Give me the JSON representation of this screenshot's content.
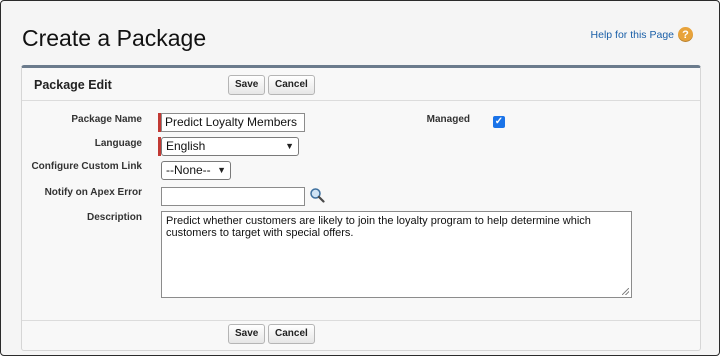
{
  "page": {
    "title": "Create a Package",
    "help_link": "Help for this Page",
    "help_icon": "question-icon"
  },
  "panel": {
    "title": "Package Edit",
    "save_label": "Save",
    "cancel_label": "Cancel"
  },
  "form": {
    "package_name": {
      "label": "Package Name",
      "value": "Predict Loyalty Members",
      "required": true
    },
    "language": {
      "label": "Language",
      "value": "English",
      "required": true
    },
    "custom_link": {
      "label": "Configure Custom Link",
      "value": "--None--"
    },
    "apex_error": {
      "label": "Notify on Apex Error",
      "value": ""
    },
    "description": {
      "label": "Description",
      "value": "Predict whether customers are likely to join the loyalty program to help determine which customers to target with special offers."
    },
    "managed": {
      "label": "Managed",
      "checked": true
    }
  },
  "colors": {
    "required": "#c23934",
    "link": "#1a5fa8",
    "checkbox": "#1a73e8",
    "help_icon": "#e8a33b",
    "panel_border_top": "#6b7b8c"
  }
}
